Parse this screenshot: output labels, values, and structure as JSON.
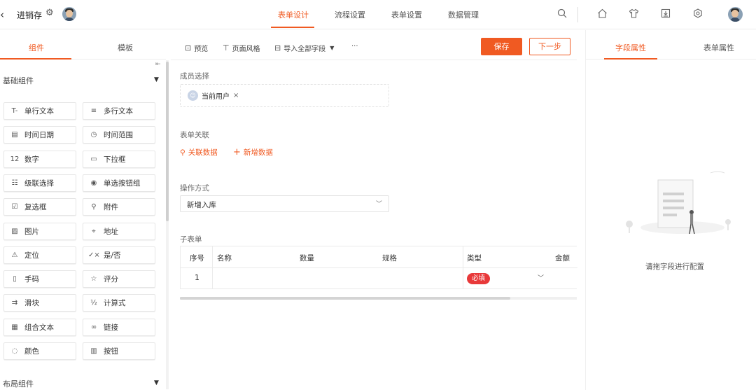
{
  "header": {
    "back_icon": "‹",
    "app_name": "进销存",
    "nav_tabs": [
      {
        "label": "表单设计",
        "active": true
      },
      {
        "label": "流程设置",
        "active": false
      },
      {
        "label": "表单设置",
        "active": false
      },
      {
        "label": "数据管理",
        "active": false
      }
    ],
    "right_icons": [
      "search-icon",
      "home-icon",
      "shirt-icon",
      "download-icon",
      "settings-icon"
    ]
  },
  "left_panel": {
    "tabs": [
      {
        "label": "组件",
        "active": true
      },
      {
        "label": "模板",
        "active": false
      }
    ],
    "basic_group": "基础组件",
    "layout_group": "布局组件",
    "components": [
      {
        "icon": "T-",
        "label": "单行文本"
      },
      {
        "icon": "≡",
        "label": "多行文本"
      },
      {
        "icon": "▤",
        "label": "时间日期"
      },
      {
        "icon": "◷",
        "label": "时间范围"
      },
      {
        "icon": "12",
        "label": "数字"
      },
      {
        "icon": "▭",
        "label": "下拉框"
      },
      {
        "icon": "☷",
        "label": "级联选择"
      },
      {
        "icon": "◉",
        "label": "单选按钮组"
      },
      {
        "icon": "☑",
        "label": "复选框"
      },
      {
        "icon": "⚲",
        "label": "附件"
      },
      {
        "icon": "▨",
        "label": "图片"
      },
      {
        "icon": "⌖",
        "label": "地址"
      },
      {
        "icon": "⚠",
        "label": "定位"
      },
      {
        "icon": "✓×",
        "label": "是/否"
      },
      {
        "icon": "▯",
        "label": "手码"
      },
      {
        "icon": "☆",
        "label": "评分"
      },
      {
        "icon": "⇉",
        "label": "滑块"
      },
      {
        "icon": "½",
        "label": "计算式"
      },
      {
        "icon": "▦",
        "label": "组合文本"
      },
      {
        "icon": "∞",
        "label": "链接"
      },
      {
        "icon": "◌",
        "label": "颜色"
      },
      {
        "icon": "▥",
        "label": "按钮"
      }
    ]
  },
  "toolbar": {
    "items": [
      {
        "icon": "⊡",
        "label": "预览"
      },
      {
        "icon": "⊤",
        "label": "页面风格"
      },
      {
        "icon": "⊟",
        "label": "导入全部字段"
      }
    ],
    "more": "···",
    "save_label": "保存",
    "next_label": "下一步"
  },
  "form": {
    "member_label": "成员选择",
    "member_chip": "当前用户",
    "member_chip_remove": "×",
    "relation_label": "表单关联",
    "relation_link1": "关联数据",
    "relation_link2": "新增数据",
    "op_label": "操作方式",
    "op_value": "新增入库",
    "subform_label": "子表单",
    "table_headers": [
      "序号",
      "名称",
      "数量",
      "规格",
      "类型",
      "金额"
    ],
    "row_index": "1",
    "row_type_badge": "必填"
  },
  "right_panel": {
    "tabs": [
      {
        "label": "字段属性",
        "active": true
      },
      {
        "label": "表单属性",
        "active": false
      }
    ],
    "empty_text": "请拖字段进行配置"
  },
  "colors": {
    "accent": "#f05a22",
    "badge_red": "#e8393a"
  }
}
